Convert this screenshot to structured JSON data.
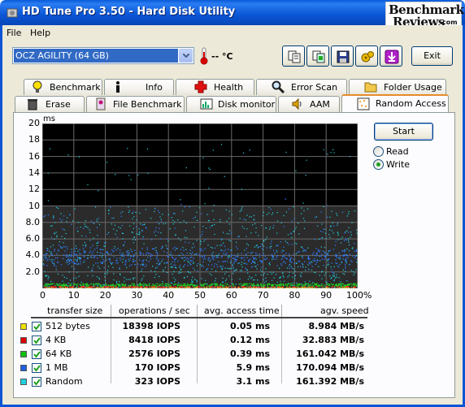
{
  "window": {
    "title": "HD Tune Pro 3.50 - Hard Disk Utility"
  },
  "logo": {
    "line1": "Benchmark",
    "line2": "Reviews",
    "suffix": ".com"
  },
  "menu": [
    {
      "label": "File"
    },
    {
      "label": "Help"
    }
  ],
  "toolbar": {
    "drive": "OCZ AGILITY (64 GB)",
    "temperature": "-- °C",
    "exit_label": "Exit",
    "buttons": [
      "copy-info-icon",
      "copy-screenshot-icon",
      "save-icon",
      "options-icon",
      "download-icon"
    ]
  },
  "tabs_top": [
    {
      "label": "Benchmark",
      "icon": "lightbulb-icon"
    },
    {
      "label": "Info",
      "icon": "info-icon"
    },
    {
      "label": "Health",
      "icon": "health-cross-icon"
    },
    {
      "label": "Error Scan",
      "icon": "magnifier-icon"
    },
    {
      "label": "Folder Usage",
      "icon": "folder-icon"
    }
  ],
  "tabs_bottom": [
    {
      "label": "Erase",
      "icon": "trash-icon"
    },
    {
      "label": "File Benchmark",
      "icon": "file-benchmark-icon"
    },
    {
      "label": "Disk monitor",
      "icon": "disk-monitor-icon"
    },
    {
      "label": "AAM",
      "icon": "speaker-icon"
    },
    {
      "label": "Random Access",
      "icon": "random-access-icon",
      "active": true
    }
  ],
  "controls": {
    "start_label": "Start",
    "radio_read": "Read",
    "radio_write": "Write",
    "selected": "Write"
  },
  "chart_data": {
    "type": "scatter",
    "ylabel": "ms",
    "y_ticks": [
      "20",
      "18",
      "16",
      "14",
      "12",
      "10",
      "8.0",
      "6.0",
      "4.0",
      "2.0"
    ],
    "x_ticks": [
      "0",
      "10",
      "20",
      "30",
      "40",
      "50",
      "60",
      "70",
      "80",
      "90",
      "100%"
    ],
    "xlim": [
      0,
      100
    ],
    "ylim": [
      0,
      20
    ],
    "grid": true,
    "background": "#000000",
    "series": [
      {
        "color": "#f0f000",
        "access_ms_mean": 0.05
      },
      {
        "color": "#ff2020",
        "access_ms_mean": 0.12
      },
      {
        "color": "#20d020",
        "access_ms_mean": 0.39
      },
      {
        "color": "#2f7bff",
        "access_ms_mean": 5.9
      },
      {
        "color": "#20d8e8",
        "access_ms_mean": 3.1
      }
    ]
  },
  "table": {
    "headers": [
      "transfer size",
      "operations / sec",
      "avg. access time",
      "agv. speed"
    ],
    "rows": [
      {
        "name": "512 bytes",
        "ops": "18398 IOPS",
        "access": "0.05 ms",
        "speed": "8.984 MB/s",
        "color": "#f0e000",
        "checked": true
      },
      {
        "name": "4 KB",
        "ops": "8418 IOPS",
        "access": "0.12 ms",
        "speed": "32.883 MB/s",
        "color": "#e00000",
        "checked": true
      },
      {
        "name": "64 KB",
        "ops": "2576 IOPS",
        "access": "0.39 ms",
        "speed": "161.042 MB/s",
        "color": "#10c010",
        "checked": true
      },
      {
        "name": "1 MB",
        "ops": "170 IOPS",
        "access": "5.9 ms",
        "speed": "170.094 MB/s",
        "color": "#2060e0",
        "checked": true
      },
      {
        "name": "Random",
        "ops": "323 IOPS",
        "access": "3.1 ms",
        "speed": "161.392 MB/s",
        "color": "#20d0e0",
        "checked": true
      }
    ]
  }
}
